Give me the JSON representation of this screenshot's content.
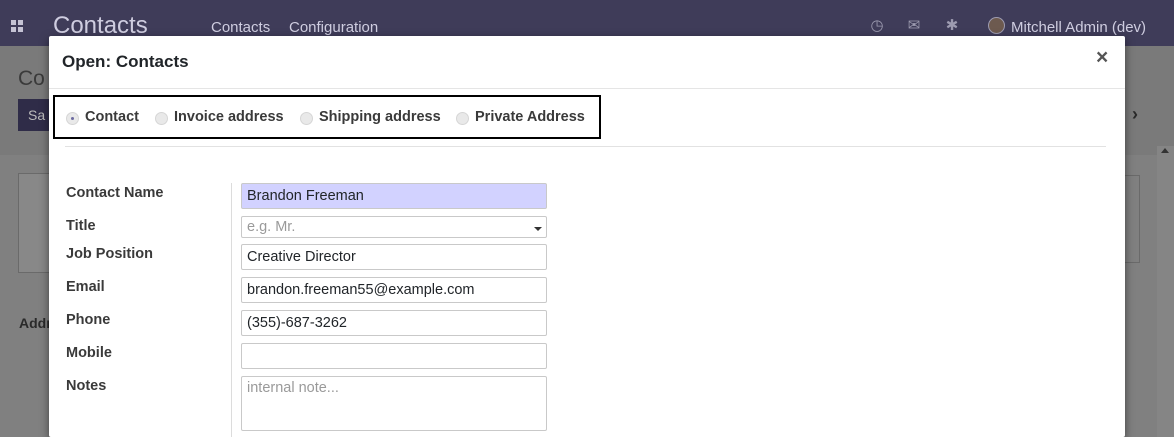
{
  "navbar": {
    "brand": "Contacts",
    "menu": [
      "Contacts",
      "Configuration"
    ],
    "user": "Mitchell Admin (dev)",
    "icons": [
      "apps-grid-icon",
      "clock-icon",
      "chat-icon",
      "bug-icon"
    ]
  },
  "background": {
    "title": "Co",
    "save_label": "Sa",
    "address_label": "Addr"
  },
  "modal": {
    "title": "Open: Contacts",
    "close_label": "×",
    "address_types": [
      {
        "label": "Contact",
        "checked": true
      },
      {
        "label": "Invoice address",
        "checked": false
      },
      {
        "label": "Shipping address",
        "checked": false
      },
      {
        "label": "Private Address",
        "checked": false
      }
    ],
    "fields": {
      "contact_name": {
        "label": "Contact Name",
        "value": "Brandon Freeman"
      },
      "title": {
        "label": "Title",
        "placeholder": "e.g. Mr."
      },
      "job_position": {
        "label": "Job Position",
        "value": "Creative Director"
      },
      "email": {
        "label": "Email",
        "value": "brandon.freeman55@example.com"
      },
      "phone": {
        "label": "Phone",
        "value": "(355)-687-3262"
      },
      "mobile": {
        "label": "Mobile",
        "value": ""
      },
      "notes": {
        "label": "Notes",
        "placeholder": "internal note..."
      }
    }
  },
  "colors": {
    "navbar": "#3f3c59",
    "required_field": "#d2d2ff"
  }
}
